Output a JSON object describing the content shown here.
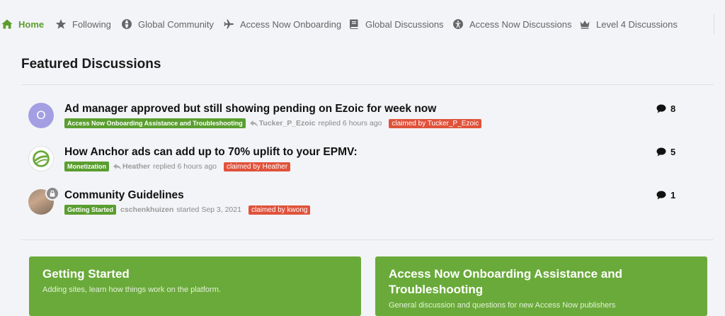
{
  "nav": {
    "items": [
      {
        "label": "Home",
        "icon": "home-icon"
      },
      {
        "label": "Following",
        "icon": "star-icon"
      },
      {
        "label": "Global Community",
        "icon": "globe-icon"
      },
      {
        "label": "Access Now Onboarding",
        "icon": "plane-icon"
      },
      {
        "label": "Global Discussions",
        "icon": "book-icon"
      },
      {
        "label": "Access Now Discussions",
        "icon": "accessibility-icon"
      },
      {
        "label": "Level 4 Discussions",
        "icon": "crown-icon"
      }
    ]
  },
  "featured": {
    "title": "Featured Discussions",
    "topics": [
      {
        "title": "Ad manager approved but still showing pending on Ezoic for week now",
        "avatar_letter": "O",
        "category": "Access Now Onboarding Assistance and Troubleshooting",
        "author": "Tucker_P_Ezoic",
        "action": "replied 6 hours ago",
        "claimed": "claimed by Tucker_P_Ezoic",
        "comments": "8"
      },
      {
        "title": "How Anchor ads can add up to 70% uplift to your EPMV:",
        "category": "Monetization",
        "author": "Heather",
        "action": "replied 6 hours ago",
        "claimed": "claimed by Heather",
        "comments": "5"
      },
      {
        "title": "Community Guidelines",
        "category": "Getting Started",
        "author": "cschenkhuizen",
        "action": "started Sep 3, 2021",
        "claimed": "claimed by kwong",
        "comments": "1"
      }
    ]
  },
  "categories": [
    {
      "title": "Getting Started",
      "description": "Adding sites, learn how things work on the platform."
    },
    {
      "title": "Access Now Onboarding Assistance and Troubleshooting",
      "description": "General discussion and questions for new Access Now publishers"
    }
  ],
  "colors": {
    "accent": "#5a9e2f",
    "claimed": "#e0523b",
    "card": "#6aaa3a"
  }
}
